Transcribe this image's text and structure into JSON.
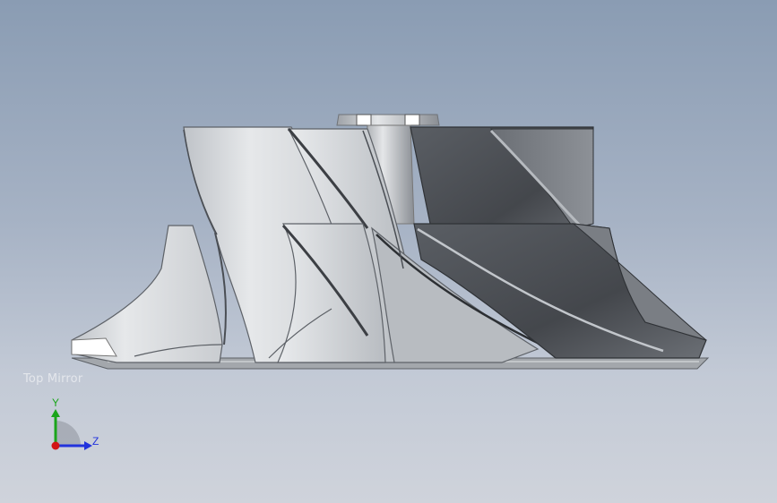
{
  "viewport": {
    "view_orientation_label": "Top Mirror",
    "background_top": "#8a9cb3",
    "background_bottom": "#cfd3db"
  },
  "model": {
    "icon": "impeller-model",
    "part_color_light": "#d9dcdf",
    "part_color_dark": "#4a4d52"
  },
  "triad": {
    "x_label": "Y",
    "z_label": "Z",
    "y_axis_color": "#1aa51a",
    "z_axis_color": "#2233dd",
    "origin_color": "#d21414"
  }
}
